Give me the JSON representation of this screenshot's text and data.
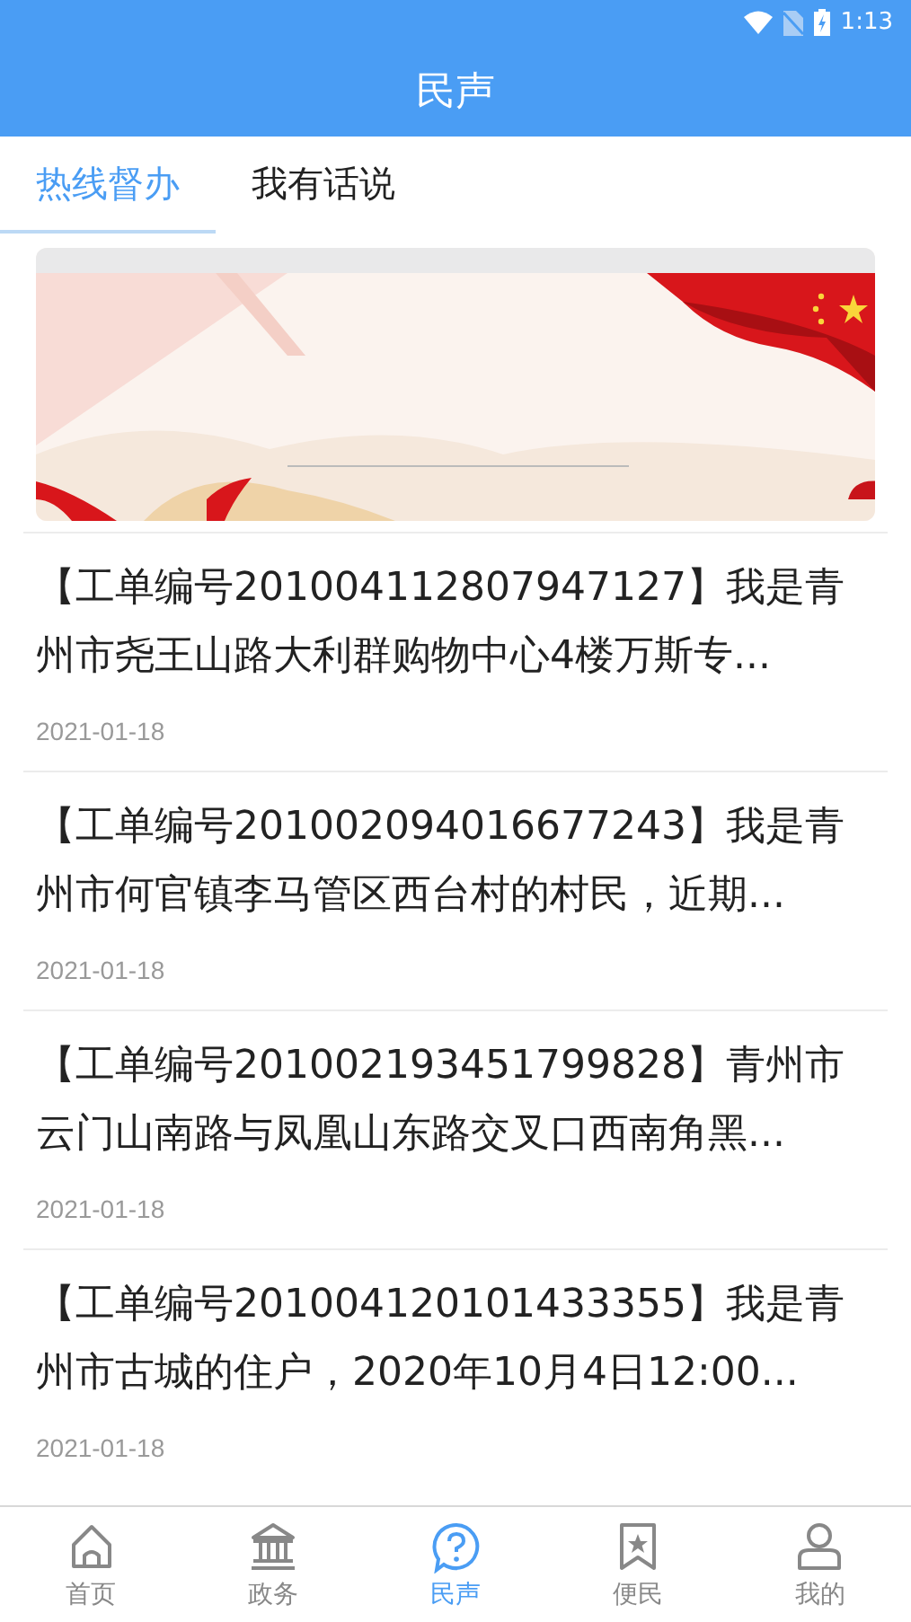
{
  "status_bar": {
    "time": "1:13"
  },
  "header": {
    "title": "民声"
  },
  "tabs": [
    {
      "label": "热线督办",
      "selected": true
    },
    {
      "label": "我有话说",
      "selected": false
    }
  ],
  "items": [
    {
      "text": "【工单编号201004112807947127】我是青州市尧王山路大利群购物中心4楼万斯专...",
      "date": "2021-01-18"
    },
    {
      "text": "【工单编号201002094016677243】我是青州市何官镇李马管区西台村的村民，近期...",
      "date": "2021-01-18"
    },
    {
      "text": "【工单编号201002193451799828】青州市云门山南路与凤凰山东路交叉口西南角黑...",
      "date": "2021-01-18"
    },
    {
      "text": "【工单编号201004120101433355】我是青州市古城的住户，2020年10月4日12:00...",
      "date": "2021-01-18"
    }
  ],
  "bottom_nav": [
    {
      "kind": "home",
      "label": "首页",
      "selected": false
    },
    {
      "kind": "bank",
      "label": "政务",
      "selected": false
    },
    {
      "kind": "question",
      "label": "民声",
      "selected": true
    },
    {
      "kind": "bookmark",
      "label": "便民",
      "selected": false
    },
    {
      "kind": "person",
      "label": "我的",
      "selected": false
    }
  ]
}
